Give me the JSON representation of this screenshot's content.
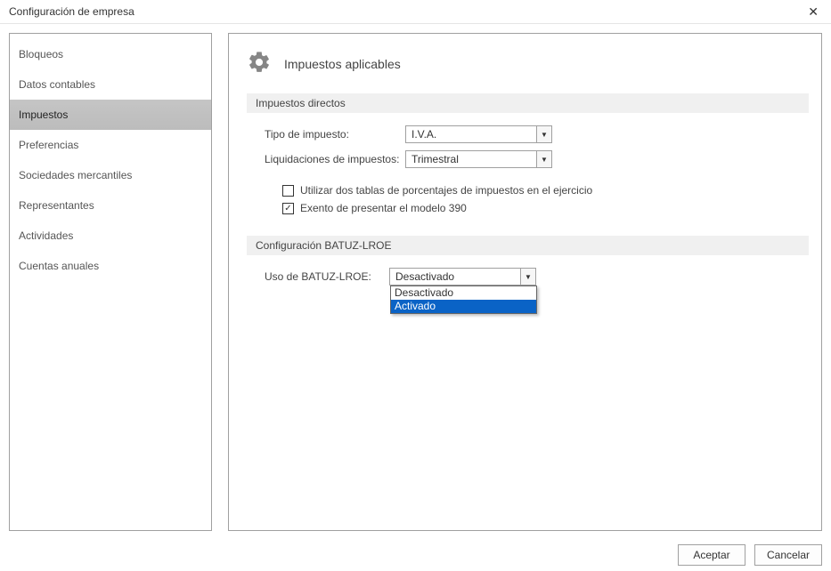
{
  "window": {
    "title": "Configuración de empresa"
  },
  "sidebar": {
    "items": [
      {
        "label": "Bloqueos"
      },
      {
        "label": "Datos contables"
      },
      {
        "label": "Impuestos"
      },
      {
        "label": "Preferencias"
      },
      {
        "label": "Sociedades mercantiles"
      },
      {
        "label": "Representantes"
      },
      {
        "label": "Actividades"
      },
      {
        "label": "Cuentas anuales"
      }
    ],
    "selected_index": 2
  },
  "header": {
    "title": "Impuestos aplicables"
  },
  "section_directos": {
    "title": "Impuestos directos",
    "tipo_label": "Tipo de impuesto:",
    "tipo_value": "I.V.A.",
    "liq_label": "Liquidaciones de impuestos:",
    "liq_value": "Trimestral",
    "check_dos_tablas_label": "Utilizar dos tablas de porcentajes de impuestos en el ejercicio",
    "check_dos_tablas_checked": false,
    "check_exento_label": "Exento de presentar el modelo 390",
    "check_exento_checked": true
  },
  "section_batuz": {
    "title": "Configuración BATUZ-LROE",
    "uso_label": "Uso de BATUZ-LROE:",
    "uso_value": "Desactivado",
    "options": [
      {
        "label": "Desactivado"
      },
      {
        "label": "Activado"
      }
    ],
    "highlighted_index": 1
  },
  "footer": {
    "accept": "Aceptar",
    "cancel": "Cancelar"
  }
}
